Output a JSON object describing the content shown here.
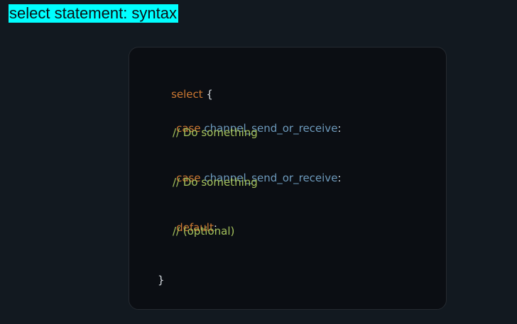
{
  "slide": {
    "title": "select statement: syntax"
  },
  "code": {
    "line1": {
      "keyword": "select",
      "punct": " {"
    },
    "case1": {
      "keyword": "case",
      "expr": " channel_send_or_receive",
      "punct": ":"
    },
    "comment1": "// Do something",
    "case2": {
      "keyword": "case",
      "expr": " channel_send_or_receive",
      "punct": ":"
    },
    "comment2": "// Do something",
    "default": {
      "keyword": "default",
      "punct": ":"
    },
    "comment3": "// (optional)",
    "close": "}"
  },
  "colors": {
    "background": "#121920",
    "title_highlight": "#00ffff",
    "card_background": "#0b0e13",
    "keyword": "#cc7832",
    "identifier": "#6c99bb",
    "comment": "#a5c25c",
    "punctuation": "#d6dbe0"
  }
}
